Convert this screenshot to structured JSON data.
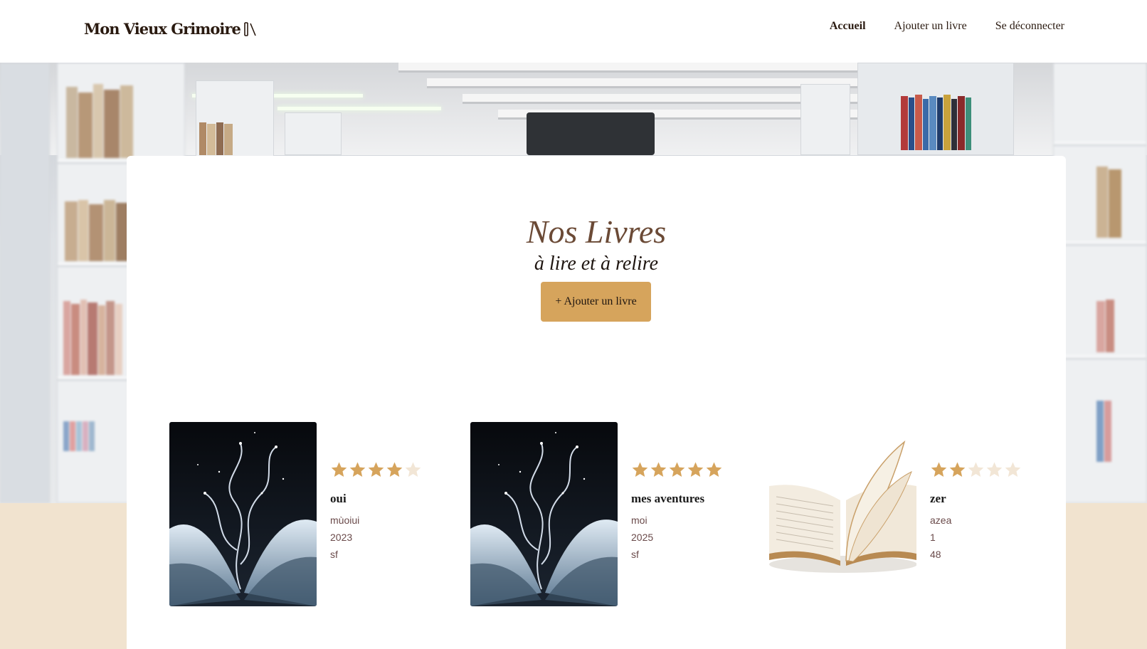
{
  "header": {
    "logo_text": "Mon Vieux Grimoire",
    "logo_icon": "books-icon",
    "nav": [
      {
        "label": "Accueil",
        "active": true
      },
      {
        "label": "Ajouter un livre",
        "active": false
      },
      {
        "label": "Se déconnecter",
        "active": false
      }
    ]
  },
  "main": {
    "title": "Nos Livres",
    "subtitle": "à lire et à relire",
    "add_button": "+ Ajouter un livre"
  },
  "books": [
    {
      "title": "oui",
      "author": "mùoiui",
      "year": "2023",
      "genre": "sf",
      "rating": 4,
      "max_rating": 5,
      "cover": "magic-book"
    },
    {
      "title": "mes aventures",
      "author": "moi",
      "year": "2025",
      "genre": "sf",
      "rating": 5,
      "max_rating": 5,
      "cover": "magic-book"
    },
    {
      "title": "zer",
      "author": "azea",
      "year": "1",
      "genre": "48",
      "rating": 2,
      "max_rating": 5,
      "cover": "open-book"
    }
  ],
  "colors": {
    "accent": "#d6a45c",
    "star_filled": "#d6a45c",
    "star_empty": "#f2e6d6",
    "title": "#6b4a36",
    "page_bg": "#f1e3cf"
  }
}
